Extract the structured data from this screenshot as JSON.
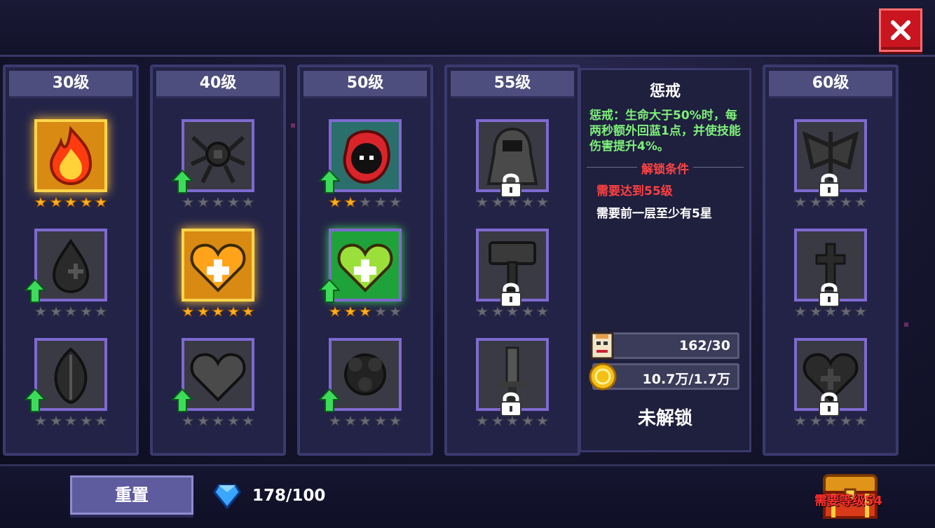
{
  "close_button": {
    "icon": "close-icon"
  },
  "tiers": [
    {
      "label": "30级",
      "skills": [
        {
          "name": "fire",
          "style": "gold",
          "stars": 5,
          "arrow": false,
          "locked": false,
          "icon": "flame-icon"
        },
        {
          "name": "drop",
          "style": "grey",
          "stars": 0,
          "arrow": true,
          "locked": false,
          "icon": "drop-icon"
        },
        {
          "name": "leaf",
          "style": "grey",
          "stars": 0,
          "arrow": true,
          "locked": false,
          "icon": "leaf-icon"
        }
      ]
    },
    {
      "label": "40级",
      "skills": [
        {
          "name": "spider",
          "style": "grey",
          "stars": 0,
          "arrow": true,
          "locked": false,
          "icon": "spider-icon"
        },
        {
          "name": "gold-heart",
          "style": "gold",
          "stars": 5,
          "arrow": false,
          "locked": false,
          "icon": "heart-plus-icon"
        },
        {
          "name": "heart",
          "style": "grey",
          "stars": 0,
          "arrow": true,
          "locked": false,
          "icon": "heart-icon"
        }
      ]
    },
    {
      "label": "50级",
      "skills": [
        {
          "name": "hood",
          "style": "teal",
          "stars": 2,
          "arrow": true,
          "locked": false,
          "icon": "hooded-face-icon"
        },
        {
          "name": "green-heart",
          "style": "green",
          "stars": 3,
          "arrow": true,
          "locked": false,
          "icon": "heart-plus-icon"
        },
        {
          "name": "orb",
          "style": "grey",
          "stars": 0,
          "arrow": true,
          "locked": false,
          "icon": "orb-icon"
        }
      ]
    },
    {
      "label": "55级",
      "skills": [
        {
          "name": "cloak",
          "style": "grey",
          "stars": 0,
          "arrow": false,
          "locked": true,
          "icon": "cloak-icon"
        },
        {
          "name": "hammer",
          "style": "grey",
          "stars": 0,
          "arrow": false,
          "locked": true,
          "icon": "hammer-icon"
        },
        {
          "name": "sword",
          "style": "grey",
          "stars": 0,
          "arrow": false,
          "locked": true,
          "icon": "sword-icon"
        }
      ]
    },
    {
      "label": "60级",
      "skills": [
        {
          "name": "wings",
          "style": "grey",
          "stars": 0,
          "arrow": false,
          "locked": true,
          "icon": "wings-icon"
        },
        {
          "name": "cross",
          "style": "grey",
          "stars": 0,
          "arrow": false,
          "locked": true,
          "icon": "cross-icon"
        },
        {
          "name": "heart-cross",
          "style": "grey",
          "stars": 0,
          "arrow": false,
          "locked": true,
          "icon": "heart-cross-icon"
        }
      ]
    }
  ],
  "detail": {
    "title": "惩戒",
    "description": "惩戒：生命大于50%时，每两秒额外回蓝1点，并使技能伤害提升4%。",
    "unlock_header": "解锁条件",
    "req_level": "需要达到55级",
    "req_stars": "需要前一层至少有5星",
    "cost_scrolls": "162/30",
    "cost_gold": "10.7万/1.7万",
    "status": "未解锁"
  },
  "bottom": {
    "reset_label": "重置",
    "gems": "178/100",
    "chest_label": "需要等级54"
  },
  "colors": {
    "accent_gold": "#ffd54a",
    "frame_purple": "#7e6ad0",
    "locked_red": "#ff4040",
    "desc_green": "#7ef07a"
  }
}
